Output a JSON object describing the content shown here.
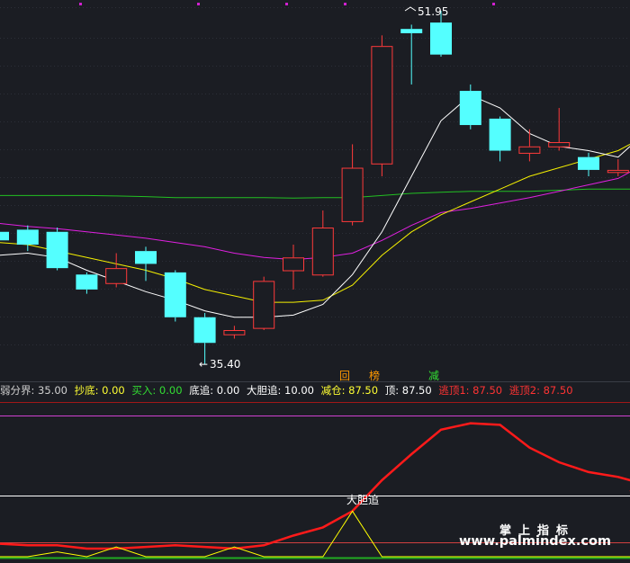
{
  "colors": {
    "background": "#1b1d23",
    "candle_up": "#ff3a3a",
    "candle_down": "#54ffff",
    "ma_white": "#ffffff",
    "ma_yellow": "#f5f000",
    "ma_magenta": "#e020e0",
    "ma_green": "#22c022",
    "indicator_red": "#ff1a1a",
    "indicator_yellow": "#ffff00"
  },
  "main_chart": {
    "high_label": "51.95",
    "low_label": "35.40",
    "markers": [
      {
        "text": "回",
        "color": "#ff9900"
      },
      {
        "text": "榜",
        "color": "#ff9900"
      },
      {
        "text": "减",
        "color": "#33dd33"
      }
    ]
  },
  "indicator_bar": {
    "items": [
      {
        "text": "弱分界: 35.00",
        "color": "#d0d0d0"
      },
      {
        "text": "抄底: 0.00",
        "color": "#ffff33"
      },
      {
        "text": "买入: 0.00",
        "color": "#33dd33"
      },
      {
        "text": "底追: 0.00",
        "color": "#ffffff"
      },
      {
        "text": "大胆追: 10.00",
        "color": "#ffffff"
      },
      {
        "text": "减仓: 87.50",
        "color": "#ffff33"
      },
      {
        "text": "顶: 87.50",
        "color": "#ffffff"
      },
      {
        "text": "逃顶1: 87.50",
        "color": "#ff3333"
      },
      {
        "text": "逃顶2: 87.50",
        "color": "#ff3333"
      }
    ]
  },
  "sub_chart": {
    "annotation": "大胆追"
  },
  "watermark": {
    "cn": "掌上指标",
    "url": "www.palmindex.com"
  },
  "chart_data": {
    "type": "candlestick",
    "candles": [
      {
        "o": 41.6,
        "c": 41.2,
        "h": 41.8,
        "l": 40.9
      },
      {
        "o": 41.7,
        "c": 41.0,
        "h": 41.9,
        "l": 40.7
      },
      {
        "o": 41.6,
        "c": 39.9,
        "h": 41.8,
        "l": 39.8
      },
      {
        "o": 39.6,
        "c": 38.9,
        "h": 39.7,
        "l": 38.7
      },
      {
        "o": 39.2,
        "c": 39.9,
        "h": 40.6,
        "l": 39.0
      },
      {
        "o": 40.7,
        "c": 40.1,
        "h": 40.9,
        "l": 39.3
      },
      {
        "o": 39.7,
        "c": 37.6,
        "h": 39.8,
        "l": 37.4
      },
      {
        "o": 37.6,
        "c": 36.4,
        "h": 37.8,
        "l": 35.4
      },
      {
        "o": 36.8,
        "c": 37.0,
        "h": 37.2,
        "l": 36.6
      },
      {
        "o": 37.1,
        "c": 39.3,
        "h": 39.5,
        "l": 37.0
      },
      {
        "o": 39.8,
        "c": 40.4,
        "h": 41.0,
        "l": 38.9
      },
      {
        "o": 39.6,
        "c": 41.8,
        "h": 42.6,
        "l": 39.5
      },
      {
        "o": 42.1,
        "c": 44.6,
        "h": 45.7,
        "l": 41.9
      },
      {
        "o": 44.8,
        "c": 50.3,
        "h": 50.8,
        "l": 44.2
      },
      {
        "o": 51.1,
        "c": 50.9,
        "h": 51.3,
        "l": 48.5
      },
      {
        "o": 51.4,
        "c": 49.9,
        "h": 51.95,
        "l": 49.8
      },
      {
        "o": 48.2,
        "c": 46.6,
        "h": 48.5,
        "l": 46.4
      },
      {
        "o": 46.9,
        "c": 45.4,
        "h": 47.0,
        "l": 44.9
      },
      {
        "o": 45.3,
        "c": 45.6,
        "h": 46.4,
        "l": 44.9
      },
      {
        "o": 45.6,
        "c": 45.8,
        "h": 47.4,
        "l": 45.4
      },
      {
        "o": 45.1,
        "c": 44.5,
        "h": 45.3,
        "l": 44.2
      },
      {
        "o": 44.4,
        "c": 44.5,
        "h": 45.0,
        "l": 44.2
      }
    ],
    "ma_white": [
      40.5,
      40.6,
      40.4,
      39.8,
      39.3,
      38.8,
      38.4,
      37.9,
      37.6,
      37.6,
      37.7,
      38.2,
      39.6,
      41.6,
      44.2,
      46.8,
      48.0,
      47.4,
      46.2,
      45.6,
      45.4,
      45.1,
      45.6
    ],
    "ma_yellow": [
      41.1,
      41.0,
      40.7,
      40.4,
      40.1,
      39.8,
      39.4,
      38.9,
      38.6,
      38.3,
      38.3,
      38.4,
      39.1,
      40.5,
      41.6,
      42.4,
      43.0,
      43.6,
      44.2,
      44.6,
      45.0,
      45.4,
      45.7
    ],
    "ma_magenta": [
      42.0,
      41.85,
      41.75,
      41.6,
      41.45,
      41.3,
      41.1,
      40.9,
      40.6,
      40.4,
      40.3,
      40.4,
      40.6,
      41.2,
      41.9,
      42.5,
      42.7,
      42.95,
      43.2,
      43.5,
      43.8,
      44.1,
      44.4
    ],
    "ma_green": [
      43.3,
      43.3,
      43.3,
      43.3,
      43.28,
      43.25,
      43.2,
      43.2,
      43.2,
      43.2,
      43.18,
      43.2,
      43.2,
      43.3,
      43.4,
      43.45,
      43.5,
      43.5,
      43.5,
      43.55,
      43.6,
      43.6,
      43.6
    ],
    "indicator_red": [
      8,
      7,
      7,
      5,
      5,
      6,
      7,
      6,
      5,
      7,
      13,
      18,
      28,
      47,
      63,
      78,
      82,
      81,
      67,
      58,
      52,
      49,
      44,
      40
    ],
    "indicator_yellow": [
      0,
      0,
      3,
      0,
      6,
      0,
      0,
      0,
      6,
      0,
      0,
      0,
      28,
      0,
      0,
      0,
      0,
      0,
      0,
      0,
      0,
      0,
      0,
      0
    ],
    "indicator_levels": {
      "white_upper": 90,
      "white_lower": 35
    }
  }
}
